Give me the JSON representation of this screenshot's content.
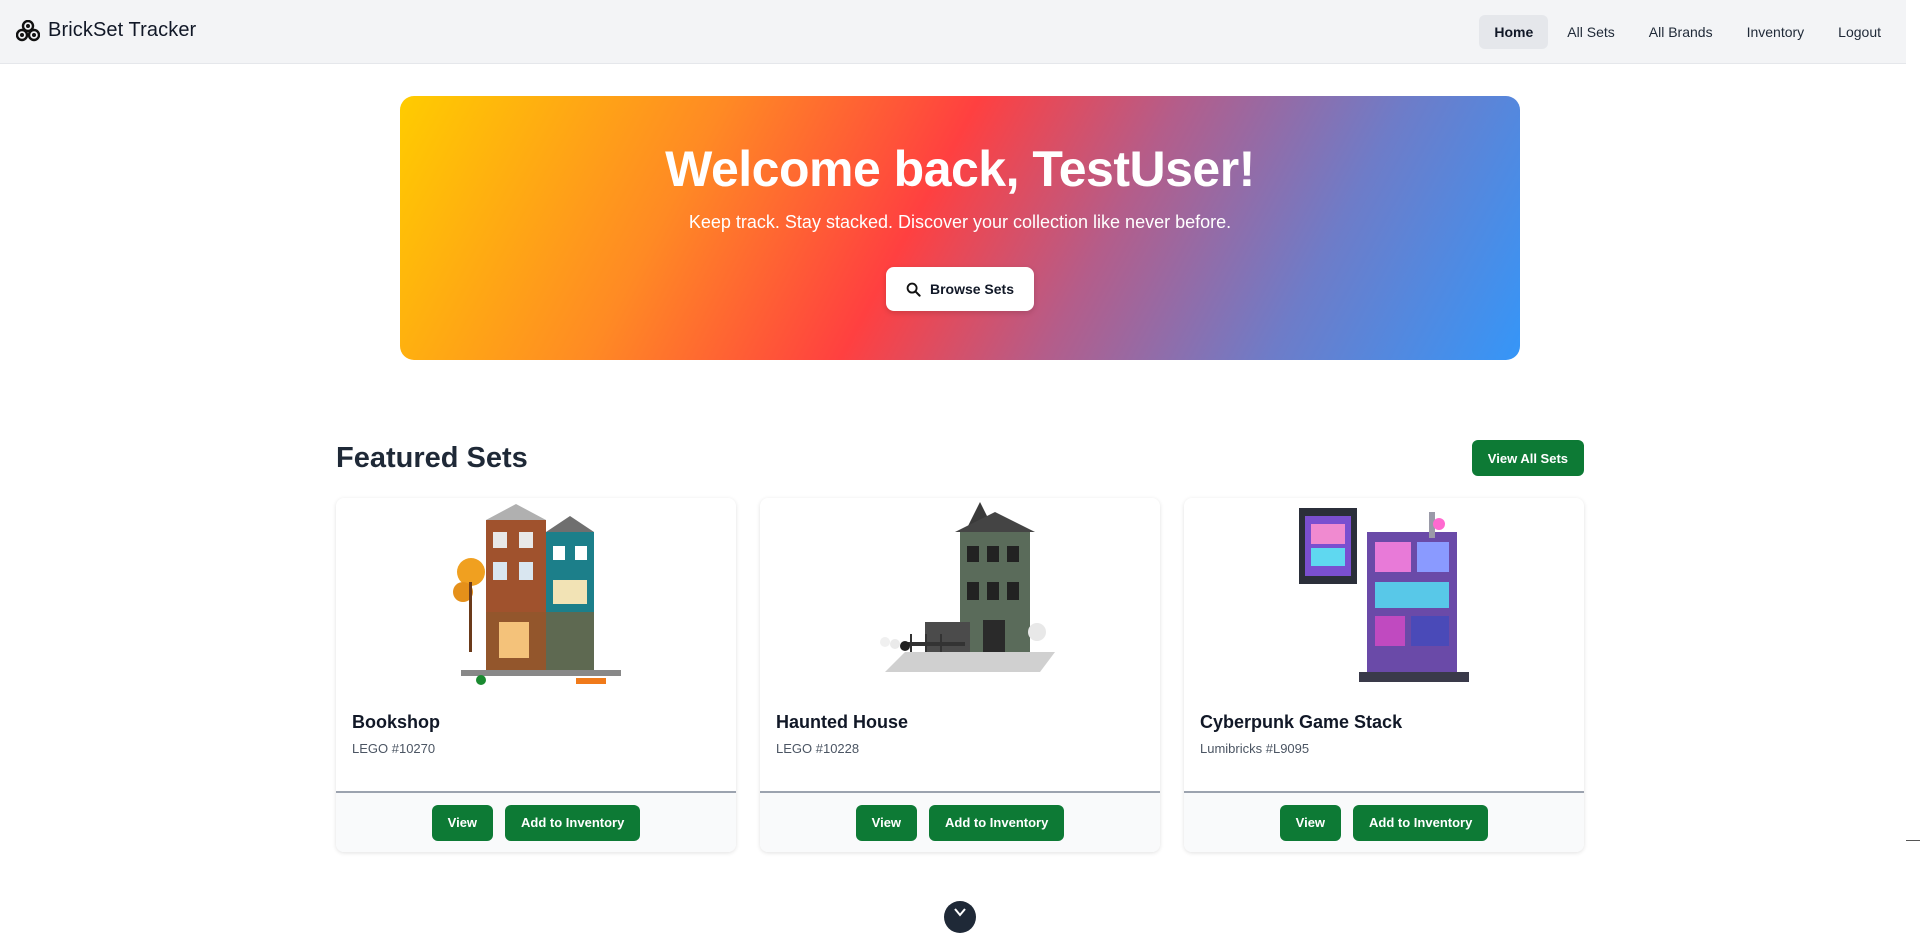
{
  "app": {
    "title": "BrickSet Tracker",
    "logo_icon": "bricks-icon"
  },
  "nav": {
    "items": [
      {
        "label": "Home",
        "active": true
      },
      {
        "label": "All Sets",
        "active": false
      },
      {
        "label": "All Brands",
        "active": false
      },
      {
        "label": "Inventory",
        "active": false
      },
      {
        "label": "Logout",
        "active": false
      }
    ]
  },
  "hero": {
    "title": "Welcome back, TestUser!",
    "subtitle": "Keep track. Stay stacked. Discover your collection like never before.",
    "button_label": "Browse Sets",
    "button_icon": "search-icon",
    "gradient_colors": [
      "#ffcc00",
      "#ff8a24",
      "#ff4040",
      "#b45d8a",
      "#6e7cc8",
      "#3596f8"
    ]
  },
  "featured": {
    "title": "Featured Sets",
    "view_all_label": "View All Sets",
    "cards": [
      {
        "name": "Bookshop",
        "meta": "LEGO #10270",
        "view_label": "View",
        "add_label": "Add to Inventory"
      },
      {
        "name": "Haunted House",
        "meta": "LEGO #10228",
        "view_label": "View",
        "add_label": "Add to Inventory"
      },
      {
        "name": "Cyberpunk Game Stack",
        "meta": "Lumibricks #L9095",
        "view_label": "View",
        "add_label": "Add to Inventory"
      }
    ]
  },
  "colors": {
    "accent_green": "#0d7a35",
    "nav_bg": "#f3f4f6"
  },
  "scroll_hint_icon": "chevron-down-icon"
}
